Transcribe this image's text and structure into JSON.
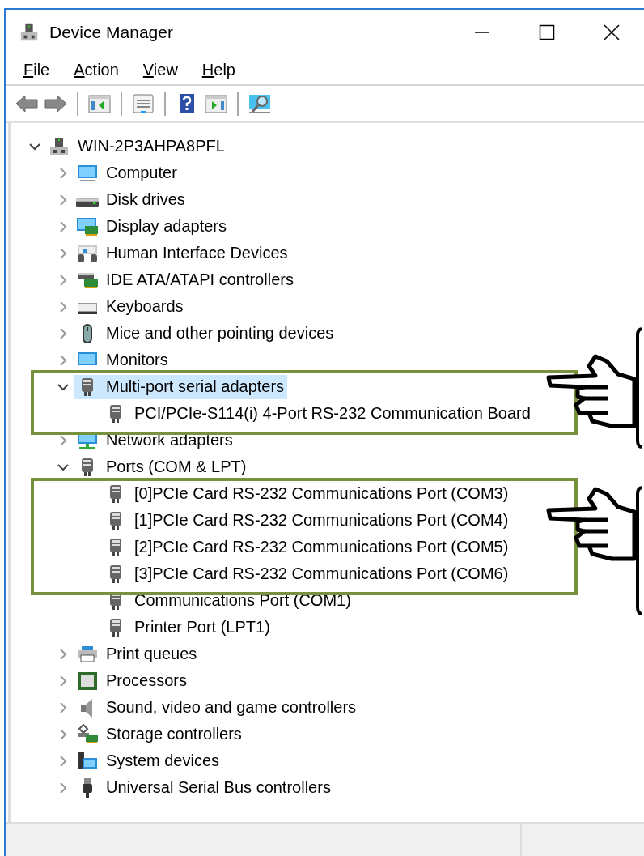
{
  "window": {
    "title": "Device Manager"
  },
  "menu": [
    {
      "label": "File"
    },
    {
      "label": "Action"
    },
    {
      "label": "View"
    },
    {
      "label": "Help"
    }
  ],
  "toolbar": [
    {
      "kind": "back"
    },
    {
      "kind": "forward"
    },
    {
      "kind": "separator"
    },
    {
      "kind": "console-tree"
    },
    {
      "kind": "separator"
    },
    {
      "kind": "properties"
    },
    {
      "kind": "separator"
    },
    {
      "kind": "help"
    },
    {
      "kind": "action-pane"
    },
    {
      "kind": "separator"
    },
    {
      "kind": "scan"
    }
  ],
  "tree": {
    "label": "WIN-2P3AHPA8PFL",
    "kind": "host",
    "expanded": true,
    "selected": false,
    "children": [
      {
        "label": "Computer",
        "kind": "computer",
        "expanded": false,
        "selected": false
      },
      {
        "label": "Disk drives",
        "kind": "disk",
        "expanded": false,
        "selected": false
      },
      {
        "label": "Display adapters",
        "kind": "display",
        "expanded": false,
        "selected": false
      },
      {
        "label": "Human Interface Devices",
        "kind": "hid",
        "expanded": false,
        "selected": false
      },
      {
        "label": "IDE ATA/ATAPI controllers",
        "kind": "ide",
        "expanded": false,
        "selected": false
      },
      {
        "label": "Keyboards",
        "kind": "keyboard",
        "expanded": false,
        "selected": false
      },
      {
        "label": "Mice and other pointing devices",
        "kind": "mouse",
        "expanded": false,
        "selected": false
      },
      {
        "label": "Monitors",
        "kind": "monitor",
        "expanded": false,
        "selected": false
      },
      {
        "label": "Multi-port serial adapters",
        "kind": "port",
        "expanded": true,
        "selected": true,
        "children": [
          {
            "label": "PCI/PCIe-S114(i) 4-Port RS-232 Communication Board",
            "kind": "port",
            "selected": false
          }
        ]
      },
      {
        "label": "Network adapters",
        "kind": "network",
        "expanded": false,
        "selected": false
      },
      {
        "label": "Ports (COM & LPT)",
        "kind": "port",
        "expanded": true,
        "selected": false,
        "children": [
          {
            "label": "[0]PCIe Card RS-232 Communications Port (COM3)",
            "kind": "port",
            "selected": false
          },
          {
            "label": "[1]PCIe Card RS-232 Communications Port (COM4)",
            "kind": "port",
            "selected": false
          },
          {
            "label": "[2]PCIe Card RS-232 Communications Port (COM5)",
            "kind": "port",
            "selected": false
          },
          {
            "label": "[3]PCIe Card RS-232 Communications Port (COM6)",
            "kind": "port",
            "selected": false
          },
          {
            "label": "Communications Port (COM1)",
            "kind": "port",
            "selected": false
          },
          {
            "label": "Printer Port (LPT1)",
            "kind": "port",
            "selected": false
          }
        ]
      },
      {
        "label": "Print queues",
        "kind": "printer",
        "expanded": false,
        "selected": false
      },
      {
        "label": "Processors",
        "kind": "processor",
        "expanded": false,
        "selected": false
      },
      {
        "label": "Sound, video and game controllers",
        "kind": "sound",
        "expanded": false,
        "selected": false
      },
      {
        "label": "Storage controllers",
        "kind": "storage",
        "expanded": false,
        "selected": false
      },
      {
        "label": "System devices",
        "kind": "system",
        "expanded": false,
        "selected": false
      },
      {
        "label": "Universal Serial Bus controllers",
        "kind": "usb",
        "expanded": false,
        "selected": false
      }
    ]
  }
}
